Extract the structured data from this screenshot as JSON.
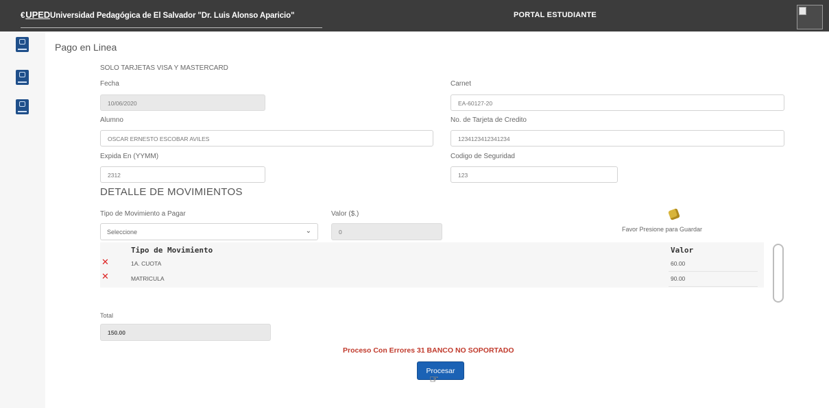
{
  "header": {
    "logo_mark": "€",
    "logo_text": "UPED",
    "university": "Universidad Pedagógica de El Salvador \"Dr. Luis Alonso Aparicio\"",
    "portal_title": "PORTAL ESTUDIANTE"
  },
  "page": {
    "title": "Pago en Linea",
    "subtitle": "SOLO TARJETAS VISA Y MASTERCARD"
  },
  "form": {
    "fecha_label": "Fecha",
    "fecha_value": "10/06/2020",
    "carnet_label": "Carnet",
    "carnet_value": "EA-60127-20",
    "alumno_label": "Alumno",
    "alumno_value": "OSCAR ERNESTO ESCOBAR AVILES",
    "tarjeta_label": "No. de Tarjeta de Credito",
    "tarjeta_value": "1234123412341234",
    "expira_label": "Expida En (YYMM)",
    "expira_value": "2312",
    "codigo_label": "Codigo de Seguridad",
    "codigo_value": "123"
  },
  "detalle": {
    "title": "DETALLE DE MOVIMIENTOS",
    "tipo_label": "Tipo de Movimiento a Pagar",
    "tipo_selected": "Seleccione",
    "valor_label": "Valor ($.)",
    "valor_value": "0",
    "save_hint": "Favor Presione para Guardar",
    "col_tipo": "Tipo de Movimiento",
    "col_valor": "Valor",
    "rows": [
      {
        "tipo": "1A. CUOTA",
        "valor": "60.00"
      },
      {
        "tipo": "MATRICULA",
        "valor": "90.00"
      }
    ]
  },
  "total": {
    "label": "Total",
    "value": "150.00"
  },
  "status": {
    "error": "Proceso Con Errores 31 BANCO NO SOPORTADO"
  },
  "actions": {
    "procesar": "Procesar"
  },
  "icons": {
    "delete": "delete-x-icon",
    "save": "save-icon",
    "cursor": "hand-cursor-icon"
  },
  "colors": {
    "topbar": "#3c3c3c",
    "primary": "#1b62b5",
    "error": "#c0392b",
    "delete": "#dd2222"
  }
}
